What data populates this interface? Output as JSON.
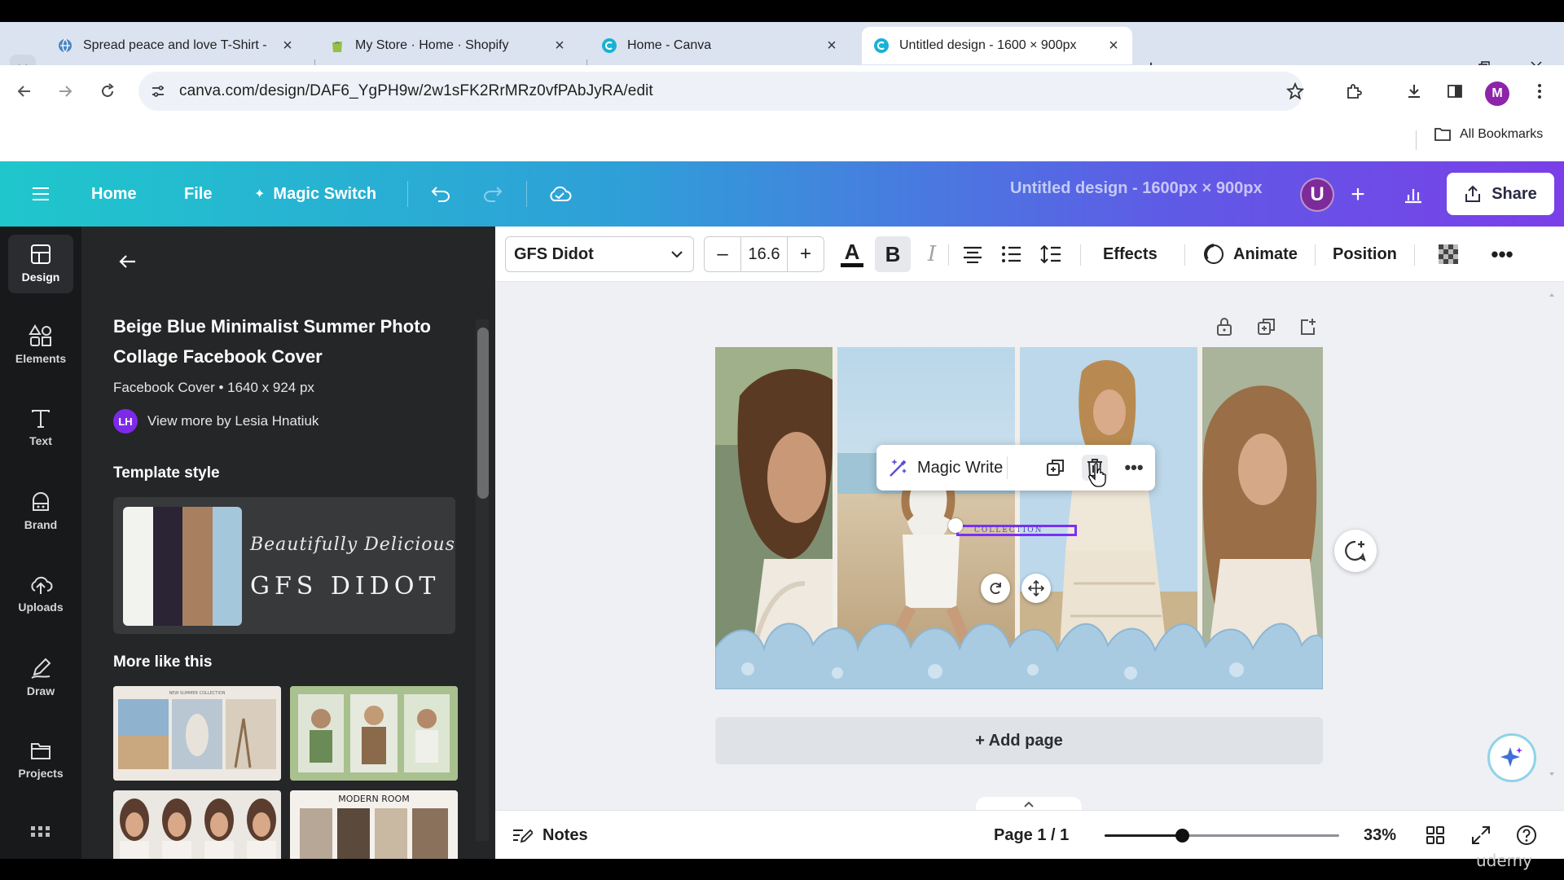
{
  "browser": {
    "tabs": [
      {
        "title": "Spread peace and love T-Shirt -",
        "favicon": "globe-icon",
        "active": false
      },
      {
        "title": "My Store · Home · Shopify",
        "favicon": "shopify-icon",
        "active": false
      },
      {
        "title": "Home - Canva",
        "favicon": "canva-icon",
        "active": false
      },
      {
        "title": "Untitled design - 1600 × 900px",
        "favicon": "canva-icon",
        "active": true
      }
    ],
    "url": "canva.com/design/DAF6_YgPH9w/2w1sFK2RrMRz0vfPAbJyRA/edit",
    "profile_initial": "M",
    "bookmarks_label": "All Bookmarks"
  },
  "header": {
    "home": "Home",
    "file": "File",
    "magic_switch": "Magic Switch",
    "doc_title": "Untitled design - 1600px × 900px",
    "user_initial": "U",
    "share": "Share",
    "colors": {
      "gradient_start": "#1fc7cc",
      "gradient_end": "#7a3fe8"
    }
  },
  "rail": {
    "items": [
      {
        "label": "Design",
        "icon": "design-icon"
      },
      {
        "label": "Elements",
        "icon": "elements-icon"
      },
      {
        "label": "Text",
        "icon": "text-icon"
      },
      {
        "label": "Brand",
        "icon": "brand-icon"
      },
      {
        "label": "Uploads",
        "icon": "uploads-icon"
      },
      {
        "label": "Draw",
        "icon": "draw-icon"
      },
      {
        "label": "Projects",
        "icon": "projects-icon"
      }
    ]
  },
  "panel": {
    "template_title": "Beige Blue Minimalist Summer Photo Collage Facebook Cover",
    "template_meta": "Facebook Cover • 1640 x 924 px",
    "author_initials": "LH",
    "author_link": "View more by Lesia Hnatiuk",
    "style_heading": "Template style",
    "style_script": "Beautifully Delicious Script",
    "style_font": "GFS DIDOT",
    "style_colors": [
      "#f2f2ef",
      "#2a2435",
      "#a9805f",
      "#a5c7dc"
    ],
    "more_heading": "More like this",
    "more_thumbs": [
      {
        "caption": "NEW SUMMER COLLECTION"
      },
      {
        "caption": ""
      },
      {
        "caption": ""
      },
      {
        "caption": "MODERN ROOM"
      }
    ]
  },
  "toolbar": {
    "font": "GFS Didot",
    "size_minus": "–",
    "font_size": "16.6",
    "size_plus": "+",
    "text_color_glyph": "A",
    "bold": "B",
    "italic": "I",
    "effects": "Effects",
    "animate": "Animate",
    "position": "Position",
    "more": "•••"
  },
  "canvas": {
    "selected_text": "COLLECTION",
    "context_menu": {
      "magic_write": "Magic Write",
      "more": "•••"
    },
    "add_page": "+ Add page"
  },
  "footer": {
    "notes": "Notes",
    "page_indicator": "Page 1 / 1",
    "zoom": "33%",
    "zoom_level": 0.33
  },
  "watermark": "udemy"
}
